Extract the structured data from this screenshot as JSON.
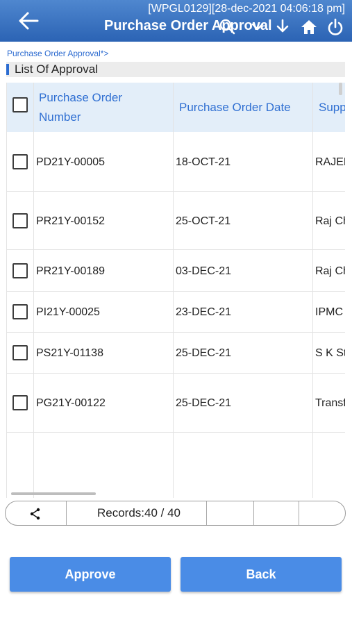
{
  "header": {
    "subtitle": "[WPGL0129][28-dec-2021 04:06:18 pm]",
    "title": "Purchase Order Approval",
    "icons": [
      "back-arrow-icon",
      "search-icon",
      "chevron-down-icon",
      "download-icon",
      "home-icon",
      "power-icon"
    ]
  },
  "breadcrumb": "Purchase Order Approval*>",
  "section": {
    "label": "List Of Approval"
  },
  "table": {
    "columns": [
      "Purchase Order Number",
      "Purchase Order Date",
      "Supp"
    ],
    "rows": [
      {
        "number": "PD21Y-00005",
        "date": "18-OCT-21",
        "supplier": "RAJEN"
      },
      {
        "number": "PR21Y-00152",
        "date": "25-OCT-21",
        "supplier": "Raj Ch"
      },
      {
        "number": "PR21Y-00189",
        "date": "03-DEC-21",
        "supplier": "Raj Ch"
      },
      {
        "number": "PI21Y-00025",
        "date": "23-DEC-21",
        "supplier": "IPMC"
      },
      {
        "number": "PS21Y-01138",
        "date": "25-DEC-21",
        "supplier": "S K St"
      },
      {
        "number": "PG21Y-00122",
        "date": "25-DEC-21",
        "supplier": "Transf"
      }
    ]
  },
  "pager": {
    "records": "Records:40 / 40",
    "icon": "share-icon"
  },
  "buttons": {
    "approve": "Approve",
    "back": "Back"
  },
  "colors": {
    "header": "#2b63b4",
    "accent": "#2f6fd2",
    "button": "#4a8ce6",
    "grid_header": "#e3eef9"
  }
}
